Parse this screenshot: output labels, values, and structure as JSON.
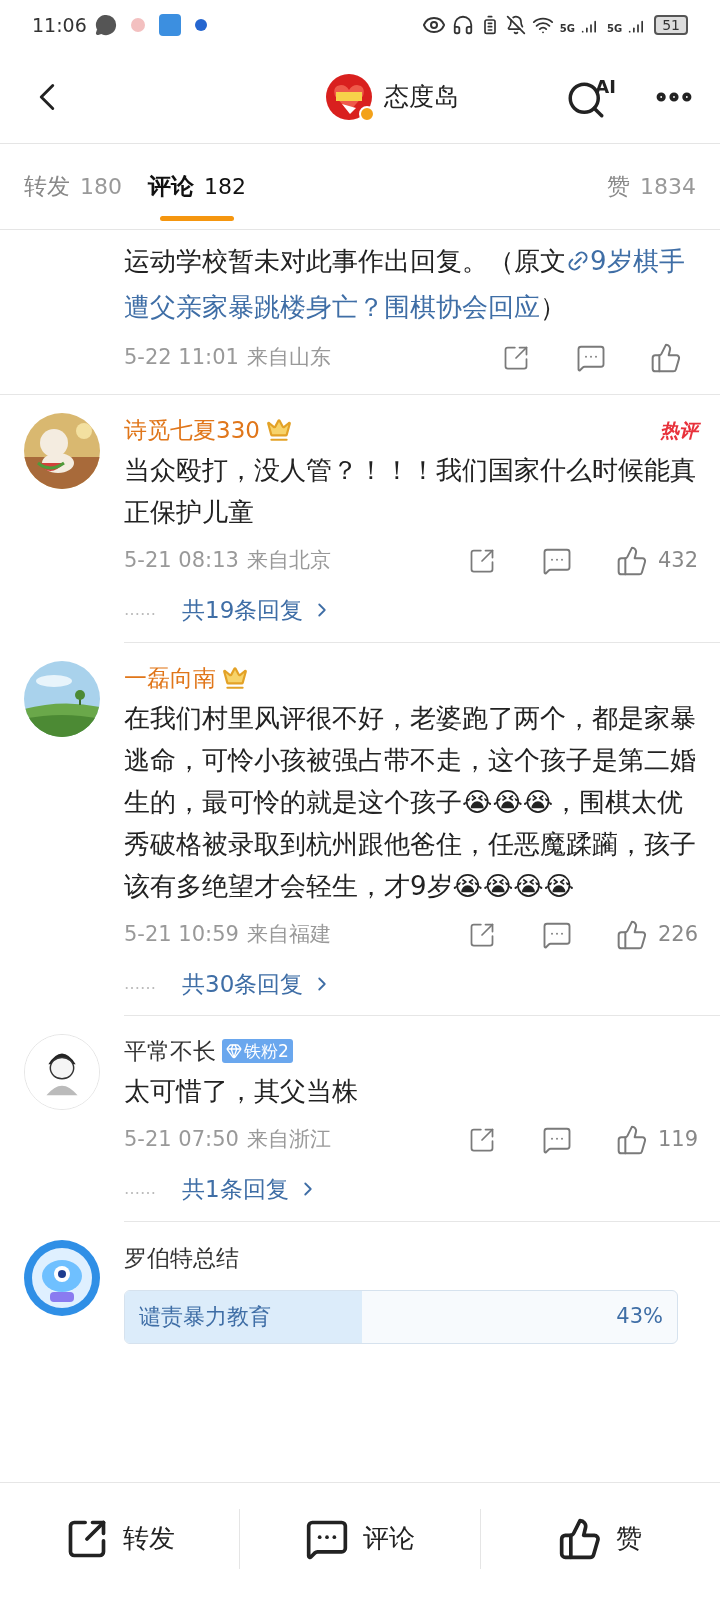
{
  "status_bar": {
    "time": "11:06",
    "battery": "51",
    "network_1": "5G",
    "network_2": "5G"
  },
  "header": {
    "title": "态度岛",
    "ai_label": "AI"
  },
  "tabs": [
    {
      "label": "转发",
      "count": "180",
      "selected": false
    },
    {
      "label": "评论",
      "count": "182",
      "selected": true
    },
    {
      "label": "赞",
      "count": "1834",
      "selected": false
    }
  ],
  "top_comment": {
    "segments": [
      {
        "kind": "plain",
        "text": "运动学校暂未对此事作出回复。（原文"
      },
      {
        "kind": "link",
        "text": "9岁棋手"
      },
      {
        "kind": "link_continued",
        "text": "遭父亲家暴跳楼身亡？围棋协会回应"
      },
      {
        "kind": "plain",
        "text": "）"
      }
    ],
    "date": "5-22 11:01",
    "location": "来自山东"
  },
  "comments": [
    {
      "name": "诗觅七夏330",
      "vip": true,
      "badge": {
        "kind": "crown"
      },
      "hot_label": "热评",
      "text": "当众殴打，没人管？！！！我们国家什么时候能真正保护儿童",
      "date": "5-21 08:13",
      "location": "来自北京",
      "likes": "432",
      "dots": "……",
      "replies": "共19条回复"
    },
    {
      "name": "一磊向南",
      "vip": true,
      "badge": {
        "kind": "crown"
      },
      "text": "在我们村里风评很不好，老婆跑了两个，都是家暴逃命，可怜小孩被强占带不走，这个孩子是第二婚生的，最可怜的就是这个孩子😭😭😭，围棋太优秀破格被录取到杭州跟他爸住，任恶魔蹂躏，孩子该有多绝望才会轻生，才9岁😭😭😭😭",
      "date": "5-21 10:59",
      "location": "来自福建",
      "likes": "226",
      "dots": "……",
      "replies": "共30条回复"
    },
    {
      "name": "平常不长",
      "vip": false,
      "badge": {
        "kind": "fan",
        "label": "铁粉2"
      },
      "text": "太可惜了，其父当株",
      "date": "5-21 07:50",
      "location": "来自浙江",
      "likes": "119",
      "dots": "……",
      "replies": "共1条回复"
    }
  ],
  "summary": {
    "name": "罗伯特总结",
    "poll": {
      "option": "谴责暴力教育",
      "percent": "43%",
      "level": 0.43
    }
  },
  "bottom_bar": [
    {
      "kind": "share",
      "label": "转发"
    },
    {
      "kind": "comment",
      "label": "评论"
    },
    {
      "kind": "like",
      "label": "赞"
    }
  ]
}
